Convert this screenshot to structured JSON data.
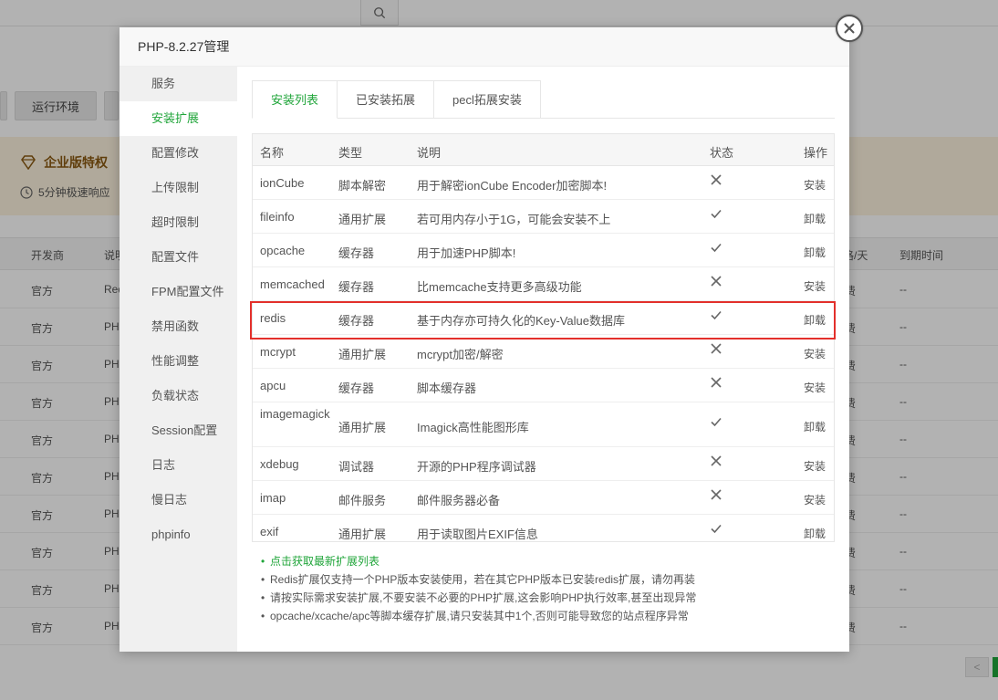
{
  "background": {
    "tabs": [
      "运行环境"
    ],
    "vip": {
      "title": "企业版特权",
      "subtitle": "5分钟极速响应"
    },
    "table_headers": [
      "开发商",
      "说明",
      "价格/天",
      "到期时间"
    ],
    "rows": [
      {
        "vendor": "官方",
        "desc": "Red",
        "price": "费",
        "expire": "--"
      },
      {
        "vendor": "官方",
        "desc": "PH",
        "price": "费",
        "expire": "--"
      },
      {
        "vendor": "官方",
        "desc": "PH",
        "price": "费",
        "expire": "--"
      },
      {
        "vendor": "官方",
        "desc": "PH",
        "price": "费",
        "expire": "--"
      },
      {
        "vendor": "官方",
        "desc": "PH",
        "price": "费",
        "expire": "--"
      },
      {
        "vendor": "官方",
        "desc": "PH",
        "price": "费",
        "expire": "--"
      },
      {
        "vendor": "官方",
        "desc": "PH",
        "price": "费",
        "expire": "--"
      },
      {
        "vendor": "官方",
        "desc": "PH",
        "price": "费",
        "expire": "--"
      },
      {
        "vendor": "官方",
        "desc": "PH",
        "price": "费",
        "expire": "--"
      },
      {
        "vendor": "官方",
        "desc": "PH",
        "price": "费",
        "expire": "--"
      }
    ],
    "pager_prev": "<"
  },
  "modal": {
    "title": "PHP-8.2.27管理",
    "sidebar": [
      {
        "label": "服务",
        "active": false
      },
      {
        "label": "安装扩展",
        "active": true
      },
      {
        "label": "配置修改",
        "active": false
      },
      {
        "label": "上传限制",
        "active": false
      },
      {
        "label": "超时限制",
        "active": false
      },
      {
        "label": "配置文件",
        "active": false
      },
      {
        "label": "FPM配置文件",
        "active": false
      },
      {
        "label": "禁用函数",
        "active": false
      },
      {
        "label": "性能调整",
        "active": false
      },
      {
        "label": "负载状态",
        "active": false
      },
      {
        "label": "Session配置",
        "active": false
      },
      {
        "label": "日志",
        "active": false
      },
      {
        "label": "慢日志",
        "active": false
      },
      {
        "label": "phpinfo",
        "active": false
      }
    ],
    "tabs": [
      {
        "label": "安装列表",
        "active": true
      },
      {
        "label": "已安装拓展",
        "active": false
      },
      {
        "label": "pecl拓展安装",
        "active": false
      }
    ],
    "table": {
      "headers": {
        "name": "名称",
        "type": "类型",
        "desc": "说明",
        "status": "状态",
        "op": "操作"
      },
      "rows": [
        {
          "name": "ionCube",
          "type": "脚本解密",
          "desc": "用于解密ionCube Encoder加密脚本!",
          "installed": false,
          "op": "安装"
        },
        {
          "name": "fileinfo",
          "type": "通用扩展",
          "desc": "若可用内存小于1G，可能会安装不上",
          "installed": true,
          "op": "卸载"
        },
        {
          "name": "opcache",
          "type": "缓存器",
          "desc": "用于加速PHP脚本!",
          "installed": true,
          "op": "卸载"
        },
        {
          "name": "memcached",
          "type": "缓存器",
          "desc": "比memcache支持更多高级功能",
          "installed": false,
          "op": "安装"
        },
        {
          "name": "redis",
          "type": "缓存器",
          "desc": "基于内存亦可持久化的Key-Value数据库",
          "installed": true,
          "op": "卸载"
        },
        {
          "name": "mcrypt",
          "type": "通用扩展",
          "desc": "mcrypt加密/解密",
          "installed": false,
          "op": "安装"
        },
        {
          "name": "apcu",
          "type": "缓存器",
          "desc": "脚本缓存器",
          "installed": false,
          "op": "安装"
        },
        {
          "name": "imagemagick",
          "type": "通用扩展",
          "desc": "Imagick高性能图形库",
          "installed": true,
          "op": "卸载"
        },
        {
          "name": "xdebug",
          "type": "调试器",
          "desc": "开源的PHP程序调试器",
          "installed": false,
          "op": "安装"
        },
        {
          "name": "imap",
          "type": "邮件服务",
          "desc": "邮件服务器必备",
          "installed": false,
          "op": "安装"
        },
        {
          "name": "exif",
          "type": "通用扩展",
          "desc": "用于读取图片EXIF信息",
          "installed": true,
          "op": "卸载"
        }
      ]
    },
    "notes": [
      "点击获取最新扩展列表",
      "Redis扩展仅支持一个PHP版本安装使用，若在其它PHP版本已安装redis扩展，请勿再装",
      "请按实际需求安装扩展,不要安装不必要的PHP扩展,这会影响PHP执行效率,甚至出现异常",
      "opcache/xcache/apc等脚本缓存扩展,请只安装其中1个,否则可能导致您的站点程序异常"
    ]
  },
  "colors": {
    "accent": "#20a53a",
    "danger": "#e12222",
    "highlight": "#e3302b"
  }
}
